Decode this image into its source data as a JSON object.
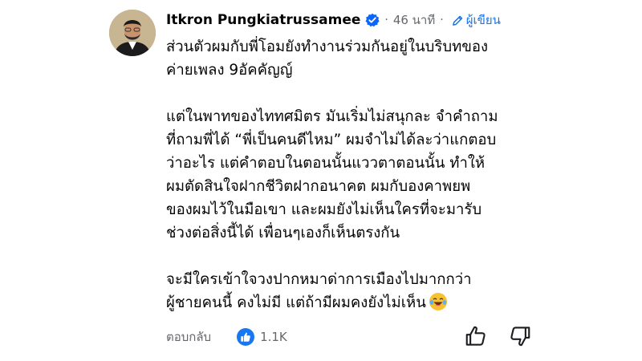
{
  "comment": {
    "author": "Itkron Pungkiatrussamee",
    "verified_icon": "verified-badge-icon",
    "time": "46 นาที",
    "role_label": "ผู้เขียน",
    "role_icon": "pencil-icon",
    "lines": [
      "ส่วนตัวผมกับพี่โอมยังทำงานร่วมกันอยู่ในบริบทของ",
      "ค่ายเพลง 9อัคคัญญ์",
      "",
      "แต่ในพาทของไททศมิตร มันเริ่มไม่สนุกละ จำคำถาม",
      "ที่ถามพี่ได้ “พี่เป็นคนดีไหม” ผมจำไม่ได้ละว่าแกตอบ",
      "ว่าอะไร แต่คำตอบในตอนนั้นแววตาตอนนั้น ทำให้",
      "ผมตัดสินใจฝากชีวิตฝากอนาคต ผมกับองคาพยพ",
      "ของผมไว้ในมือเขา และผมยังไม่เห็นใครที่จะมารับ",
      "ช่วงต่อสิ่งนี้ได้ เพื่อนๆเองก็เห็นตรงกัน",
      "",
      "จะมีใครเข้าใจวงปากหมาด่าการเมืองไปมากกว่า",
      "ผู้ชายคนนี้ คงไม่มี แต่ถ้ามีผมคงยังไม่เห็น"
    ],
    "trailing_emoji": "laughing-tears-emoji",
    "reply_label": "ตอบกลับ",
    "like_icon": "thumbs-up-icon",
    "like_count": "1.1K",
    "upvote_icon": "upvote-icon",
    "downvote_icon": "downvote-icon"
  },
  "colors": {
    "text": "#050505",
    "muted": "#65676b",
    "link_blue": "#1b74e4",
    "like_blue": "#1877f2",
    "verified_blue": "#0866ff"
  }
}
